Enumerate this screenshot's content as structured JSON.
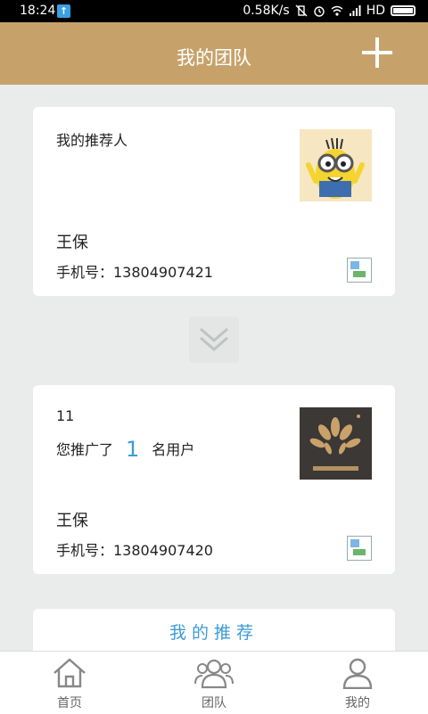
{
  "status_bar": {
    "time": "18:24",
    "speed": "0.58K/s",
    "network": "HD"
  },
  "header": {
    "title": "我的团队"
  },
  "referrer_card": {
    "label": "我的推荐人",
    "name": "王保",
    "phone": "手机号：13804907421"
  },
  "team_card": {
    "id": "11",
    "promo_prefix": "您推广了",
    "promo_count": "1",
    "promo_suffix": "名用户",
    "name": "王保",
    "phone": "手机号：13804907420"
  },
  "recommend_tab": {
    "label": "我的推荐"
  },
  "bottom_nav": {
    "items": [
      {
        "label": "首页",
        "icon": "home-icon"
      },
      {
        "label": "团队",
        "icon": "team-icon"
      },
      {
        "label": "我的",
        "icon": "user-icon"
      }
    ]
  },
  "colors": {
    "header_bg": "#c6a26a",
    "accent_blue": "#3c9bd6",
    "page_bg": "#e9ecea"
  }
}
